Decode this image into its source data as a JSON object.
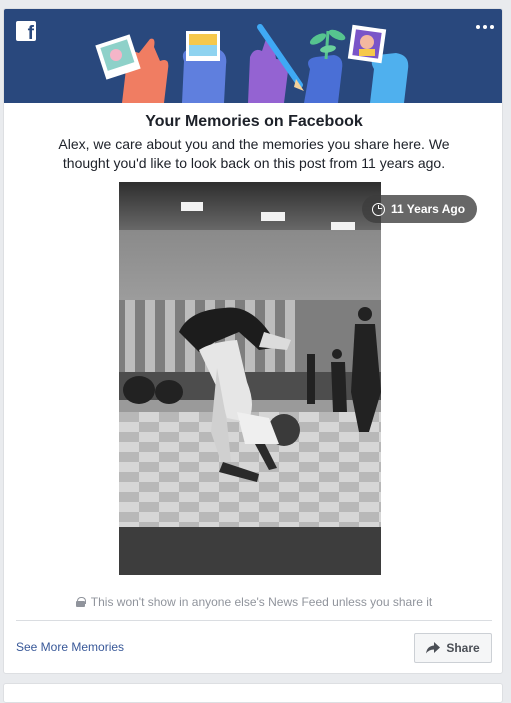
{
  "banner": {
    "logo_glyph": "f",
    "background": "#29487d",
    "icons": [
      "facebook-logo-icon",
      "more-options-icon"
    ]
  },
  "card": {
    "title": "Your Memories on Facebook",
    "subtitle": "Alex, we care about you and the memories you share here. We thought you'd like to look back on this post from 11 years ago."
  },
  "photo": {
    "badge_label": "11 Years Ago",
    "badge_icon": "clock-icon"
  },
  "privacy": {
    "text": "This won't show in anyone else's News Feed unless you share it",
    "icon": "lock-icon"
  },
  "footer": {
    "see_more_label": "See More Memories",
    "share_label": "Share",
    "link_color": "#385898"
  }
}
